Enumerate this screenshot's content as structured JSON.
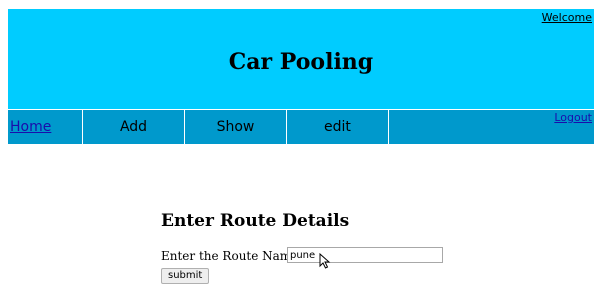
{
  "header": {
    "welcome_link": "Welcome",
    "title": "Car Pooling",
    "background_color": "#00ccff"
  },
  "nav": {
    "items": [
      {
        "label": "Home"
      },
      {
        "label": "Add"
      },
      {
        "label": "Show"
      },
      {
        "label": "edit"
      }
    ],
    "logout_link": "Logout",
    "background_color": "#0099cc"
  },
  "form": {
    "heading": "Enter Route Details",
    "route_label": "Enter the Route Name:",
    "route_value": "pune",
    "submit_label": "submit"
  },
  "icons": {
    "cursor": "mouse-pointer-icon"
  }
}
